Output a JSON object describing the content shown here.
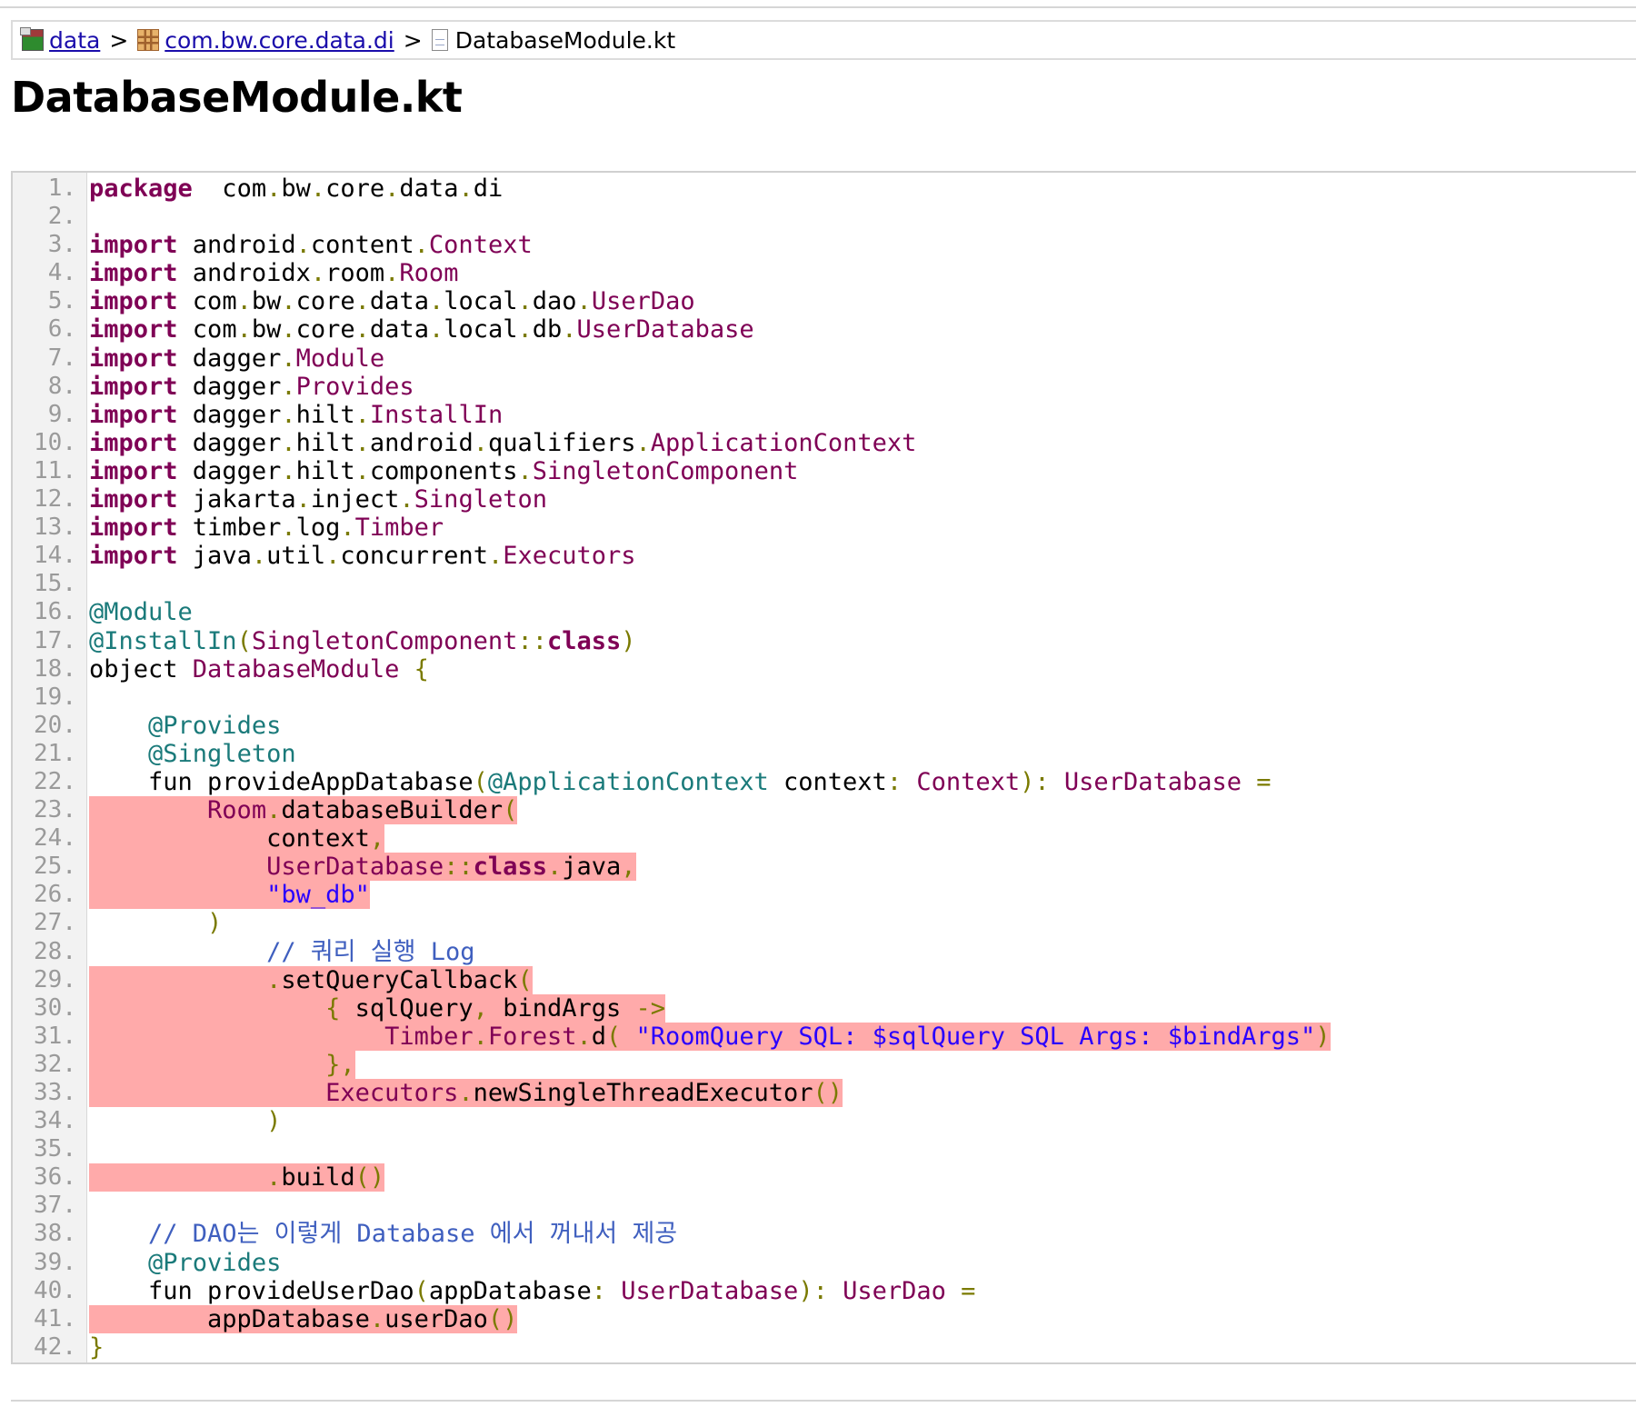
{
  "breadcrumb": {
    "items": [
      {
        "label": "data",
        "icon": "module-folder-icon",
        "link": true
      },
      {
        "label": "com.bw.core.data.di",
        "icon": "package-icon",
        "link": true
      },
      {
        "label": "DatabaseModule.kt",
        "icon": "source-file-icon",
        "link": false
      }
    ],
    "separator": ">"
  },
  "page_title": "DatabaseModule.kt",
  "coverage_highlight_color": "#ffaaaa",
  "code": {
    "lines": [
      {
        "n": "1.",
        "hl": "none",
        "tokens": [
          [
            "kw",
            "package"
          ],
          [
            "",
            "  com"
          ],
          [
            "pu",
            "."
          ],
          [
            "",
            "bw"
          ],
          [
            "pu",
            "."
          ],
          [
            "",
            "core"
          ],
          [
            "pu",
            "."
          ],
          [
            "",
            "data"
          ],
          [
            "pu",
            "."
          ],
          [
            "",
            "di"
          ]
        ]
      },
      {
        "n": "2.",
        "hl": "none",
        "tokens": []
      },
      {
        "n": "3.",
        "hl": "none",
        "tokens": [
          [
            "kw",
            "import"
          ],
          [
            "",
            " android"
          ],
          [
            "pu",
            "."
          ],
          [
            "",
            "content"
          ],
          [
            "pu",
            "."
          ],
          [
            "ty",
            "Context"
          ]
        ]
      },
      {
        "n": "4.",
        "hl": "none",
        "tokens": [
          [
            "kw",
            "import"
          ],
          [
            "",
            " androidx"
          ],
          [
            "pu",
            "."
          ],
          [
            "",
            "room"
          ],
          [
            "pu",
            "."
          ],
          [
            "ty",
            "Room"
          ]
        ]
      },
      {
        "n": "5.",
        "hl": "none",
        "tokens": [
          [
            "kw",
            "import"
          ],
          [
            "",
            " com"
          ],
          [
            "pu",
            "."
          ],
          [
            "",
            "bw"
          ],
          [
            "pu",
            "."
          ],
          [
            "",
            "core"
          ],
          [
            "pu",
            "."
          ],
          [
            "",
            "data"
          ],
          [
            "pu",
            "."
          ],
          [
            "",
            "local"
          ],
          [
            "pu",
            "."
          ],
          [
            "",
            "dao"
          ],
          [
            "pu",
            "."
          ],
          [
            "ty",
            "UserDao"
          ]
        ]
      },
      {
        "n": "6.",
        "hl": "none",
        "tokens": [
          [
            "kw",
            "import"
          ],
          [
            "",
            " com"
          ],
          [
            "pu",
            "."
          ],
          [
            "",
            "bw"
          ],
          [
            "pu",
            "."
          ],
          [
            "",
            "core"
          ],
          [
            "pu",
            "."
          ],
          [
            "",
            "data"
          ],
          [
            "pu",
            "."
          ],
          [
            "",
            "local"
          ],
          [
            "pu",
            "."
          ],
          [
            "",
            "db"
          ],
          [
            "pu",
            "."
          ],
          [
            "ty",
            "UserDatabase"
          ]
        ]
      },
      {
        "n": "7.",
        "hl": "none",
        "tokens": [
          [
            "kw",
            "import"
          ],
          [
            "",
            " dagger"
          ],
          [
            "pu",
            "."
          ],
          [
            "ty",
            "Module"
          ]
        ]
      },
      {
        "n": "8.",
        "hl": "none",
        "tokens": [
          [
            "kw",
            "import"
          ],
          [
            "",
            " dagger"
          ],
          [
            "pu",
            "."
          ],
          [
            "ty",
            "Provides"
          ]
        ]
      },
      {
        "n": "9.",
        "hl": "none",
        "tokens": [
          [
            "kw",
            "import"
          ],
          [
            "",
            " dagger"
          ],
          [
            "pu",
            "."
          ],
          [
            "",
            "hilt"
          ],
          [
            "pu",
            "."
          ],
          [
            "ty",
            "InstallIn"
          ]
        ]
      },
      {
        "n": "10.",
        "hl": "none",
        "tokens": [
          [
            "kw",
            "import"
          ],
          [
            "",
            " dagger"
          ],
          [
            "pu",
            "."
          ],
          [
            "",
            "hilt"
          ],
          [
            "pu",
            "."
          ],
          [
            "",
            "android"
          ],
          [
            "pu",
            "."
          ],
          [
            "",
            "qualifiers"
          ],
          [
            "pu",
            "."
          ],
          [
            "ty",
            "ApplicationContext"
          ]
        ]
      },
      {
        "n": "11.",
        "hl": "none",
        "tokens": [
          [
            "kw",
            "import"
          ],
          [
            "",
            " dagger"
          ],
          [
            "pu",
            "."
          ],
          [
            "",
            "hilt"
          ],
          [
            "pu",
            "."
          ],
          [
            "",
            "components"
          ],
          [
            "pu",
            "."
          ],
          [
            "ty",
            "SingletonComponent"
          ]
        ]
      },
      {
        "n": "12.",
        "hl": "none",
        "tokens": [
          [
            "kw",
            "import"
          ],
          [
            "",
            " jakarta"
          ],
          [
            "pu",
            "."
          ],
          [
            "",
            "inject"
          ],
          [
            "pu",
            "."
          ],
          [
            "ty",
            "Singleton"
          ]
        ]
      },
      {
        "n": "13.",
        "hl": "none",
        "tokens": [
          [
            "kw",
            "import"
          ],
          [
            "",
            " timber"
          ],
          [
            "pu",
            "."
          ],
          [
            "",
            "log"
          ],
          [
            "pu",
            "."
          ],
          [
            "ty",
            "Timber"
          ]
        ]
      },
      {
        "n": "14.",
        "hl": "none",
        "tokens": [
          [
            "kw",
            "import"
          ],
          [
            "",
            " java"
          ],
          [
            "pu",
            "."
          ],
          [
            "",
            "util"
          ],
          [
            "pu",
            "."
          ],
          [
            "",
            "concurrent"
          ],
          [
            "pu",
            "."
          ],
          [
            "ty",
            "Executors"
          ]
        ]
      },
      {
        "n": "15.",
        "hl": "none",
        "tokens": []
      },
      {
        "n": "16.",
        "hl": "none",
        "tokens": [
          [
            "an",
            "@Module"
          ]
        ]
      },
      {
        "n": "17.",
        "hl": "none",
        "tokens": [
          [
            "an",
            "@InstallIn"
          ],
          [
            "pu",
            "("
          ],
          [
            "ty",
            "SingletonComponent"
          ],
          [
            "pu",
            "::"
          ],
          [
            "kw",
            "class"
          ],
          [
            "pu",
            ")"
          ]
        ]
      },
      {
        "n": "18.",
        "hl": "none",
        "tokens": [
          [
            "",
            "object "
          ],
          [
            "ty",
            "DatabaseModule"
          ],
          [
            "",
            " "
          ],
          [
            "pu",
            "{"
          ]
        ]
      },
      {
        "n": "19.",
        "hl": "none",
        "tokens": []
      },
      {
        "n": "20.",
        "hl": "none",
        "tokens": [
          [
            "",
            "    "
          ],
          [
            "an",
            "@Provides"
          ]
        ]
      },
      {
        "n": "21.",
        "hl": "none",
        "tokens": [
          [
            "",
            "    "
          ],
          [
            "an",
            "@Singleton"
          ]
        ]
      },
      {
        "n": "22.",
        "hl": "none",
        "tokens": [
          [
            "",
            "    fun provideAppDatabase"
          ],
          [
            "pu",
            "("
          ],
          [
            "an",
            "@ApplicationContext"
          ],
          [
            "",
            " context"
          ],
          [
            "pu",
            ":"
          ],
          [
            "",
            " "
          ],
          [
            "ty",
            "Context"
          ],
          [
            "pu",
            "):"
          ],
          [
            "",
            " "
          ],
          [
            "ty",
            "UserDatabase"
          ],
          [
            "",
            " "
          ],
          [
            "pu",
            "="
          ]
        ]
      },
      {
        "n": "23.",
        "hl": "full",
        "tokens": [
          [
            "",
            "        "
          ],
          [
            "ty",
            "Room"
          ],
          [
            "pu",
            "."
          ],
          [
            "",
            "databaseBuilder"
          ],
          [
            "pu",
            "("
          ]
        ]
      },
      {
        "n": "24.",
        "hl": "full",
        "tokens": [
          [
            "",
            "            context"
          ],
          [
            "pu",
            ","
          ]
        ]
      },
      {
        "n": "25.",
        "hl": "full",
        "tokens": [
          [
            "",
            "            "
          ],
          [
            "ty",
            "UserDatabase"
          ],
          [
            "pu",
            "::"
          ],
          [
            "kw",
            "class"
          ],
          [
            "pu",
            "."
          ],
          [
            "",
            "java"
          ],
          [
            "pu",
            ","
          ]
        ]
      },
      {
        "n": "26.",
        "hl": "full",
        "tokens": [
          [
            "",
            "            "
          ],
          [
            "st",
            "\"bw_db\""
          ]
        ]
      },
      {
        "n": "27.",
        "hl": "none",
        "tokens": [
          [
            "",
            "        "
          ],
          [
            "pu",
            ")"
          ]
        ]
      },
      {
        "n": "28.",
        "hl": "none",
        "tokens": [
          [
            "",
            "            "
          ],
          [
            "cm",
            "// 쿼리 실행 Log"
          ]
        ]
      },
      {
        "n": "29.",
        "hl": "full",
        "tokens": [
          [
            "",
            "            "
          ],
          [
            "pu",
            "."
          ],
          [
            "",
            "setQueryCallback"
          ],
          [
            "pu",
            "("
          ]
        ]
      },
      {
        "n": "30.",
        "hl": "full",
        "tokens": [
          [
            "",
            "                "
          ],
          [
            "pu",
            "{"
          ],
          [
            "",
            " sqlQuery"
          ],
          [
            "pu",
            ","
          ],
          [
            "",
            " bindArgs "
          ],
          [
            "pu",
            "->"
          ]
        ]
      },
      {
        "n": "31.",
        "hl": "full",
        "tokens": [
          [
            "",
            "                    "
          ],
          [
            "ty",
            "Timber"
          ],
          [
            "pu",
            "."
          ],
          [
            "ty",
            "Forest"
          ],
          [
            "pu",
            "."
          ],
          [
            "",
            "d"
          ],
          [
            "pu",
            "("
          ],
          [
            "",
            " "
          ],
          [
            "st",
            "\"RoomQuery SQL: $sqlQuery SQL Args: $bindArgs\""
          ],
          [
            "pu",
            ")"
          ]
        ]
      },
      {
        "n": "32.",
        "hl": "full",
        "tokens": [
          [
            "",
            "                "
          ],
          [
            "pu",
            "},"
          ]
        ]
      },
      {
        "n": "33.",
        "hl": "full",
        "tokens": [
          [
            "",
            "                "
          ],
          [
            "ty",
            "Executors"
          ],
          [
            "pu",
            "."
          ],
          [
            "",
            "newSingleThreadExecutor"
          ],
          [
            "pu",
            "()"
          ]
        ]
      },
      {
        "n": "34.",
        "hl": "none",
        "tokens": [
          [
            "",
            "            "
          ],
          [
            "pu",
            ")"
          ]
        ]
      },
      {
        "n": "35.",
        "hl": "none",
        "tokens": []
      },
      {
        "n": "36.",
        "hl": "full",
        "tokens": [
          [
            "",
            "            "
          ],
          [
            "pu",
            "."
          ],
          [
            "",
            "build"
          ],
          [
            "pu",
            "()"
          ]
        ]
      },
      {
        "n": "37.",
        "hl": "none",
        "tokens": []
      },
      {
        "n": "38.",
        "hl": "none",
        "tokens": [
          [
            "",
            "    "
          ],
          [
            "cm",
            "// DAO는 이렇게 Database 에서 꺼내서 제공"
          ]
        ]
      },
      {
        "n": "39.",
        "hl": "none",
        "tokens": [
          [
            "",
            "    "
          ],
          [
            "an",
            "@Provides"
          ]
        ]
      },
      {
        "n": "40.",
        "hl": "none",
        "tokens": [
          [
            "",
            "    fun provideUserDao"
          ],
          [
            "pu",
            "("
          ],
          [
            "",
            "appDatabase"
          ],
          [
            "pu",
            ":"
          ],
          [
            "",
            " "
          ],
          [
            "ty",
            "UserDatabase"
          ],
          [
            "pu",
            "):"
          ],
          [
            "",
            " "
          ],
          [
            "ty",
            "UserDao"
          ],
          [
            "",
            " "
          ],
          [
            "pu",
            "="
          ]
        ]
      },
      {
        "n": "41.",
        "hl": "full",
        "tokens": [
          [
            "",
            "        appDatabase"
          ],
          [
            "pu",
            "."
          ],
          [
            "",
            "userDao"
          ],
          [
            "pu",
            "()"
          ]
        ]
      },
      {
        "n": "42.",
        "hl": "none",
        "tokens": [
          [
            "pu",
            "}"
          ]
        ]
      }
    ]
  }
}
